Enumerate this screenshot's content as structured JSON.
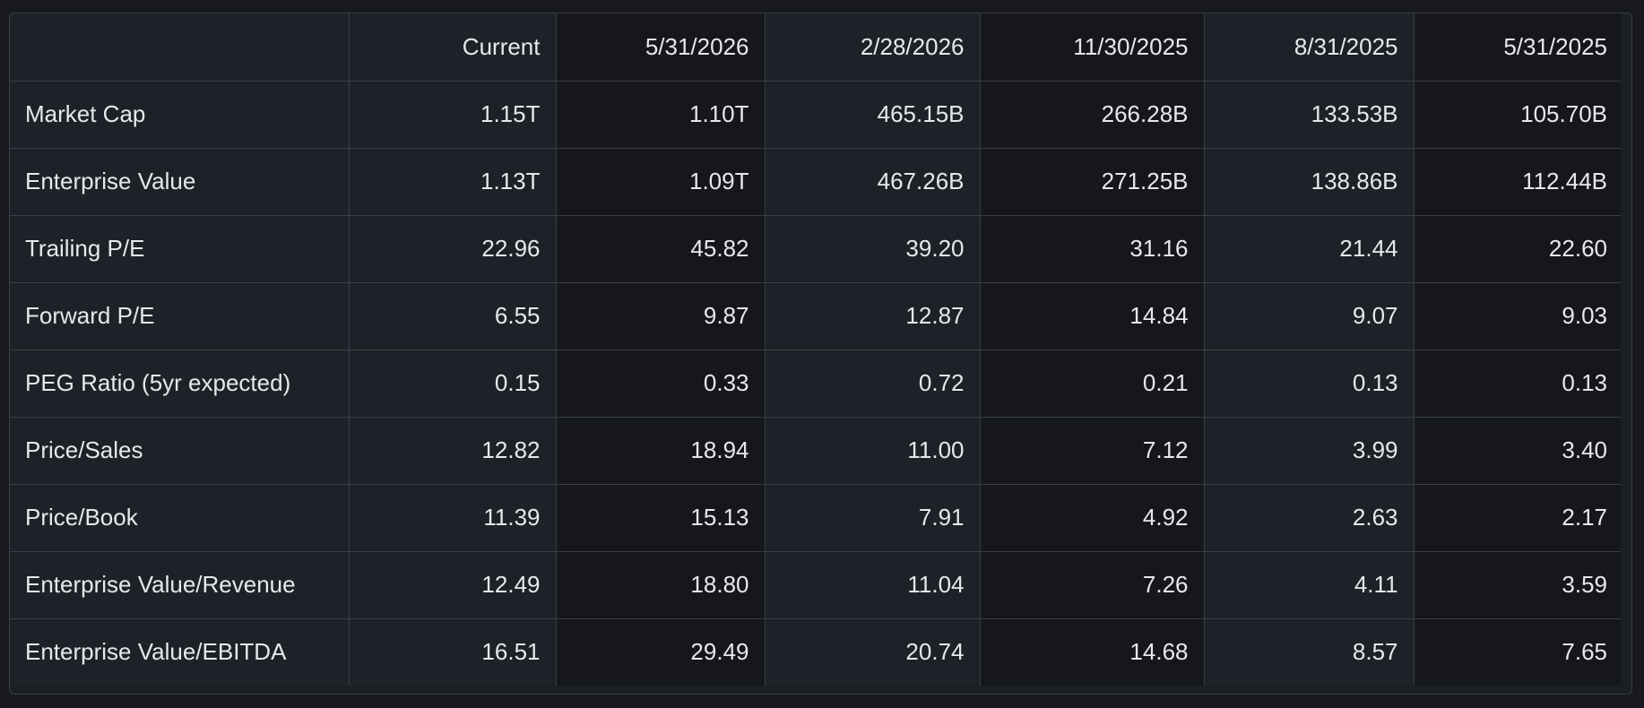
{
  "table": {
    "columns": [
      "",
      "Current",
      "5/31/2026",
      "2/28/2026",
      "11/30/2025",
      "8/31/2025",
      "5/31/2025"
    ],
    "rows": [
      {
        "label": "Market Cap",
        "values": [
          "1.15T",
          "1.10T",
          "465.15B",
          "266.28B",
          "133.53B",
          "105.70B"
        ]
      },
      {
        "label": "Enterprise Value",
        "values": [
          "1.13T",
          "1.09T",
          "467.26B",
          "271.25B",
          "138.86B",
          "112.44B"
        ]
      },
      {
        "label": "Trailing P/E",
        "values": [
          "22.96",
          "45.82",
          "39.20",
          "31.16",
          "21.44",
          "22.60"
        ]
      },
      {
        "label": "Forward P/E",
        "values": [
          "6.55",
          "9.87",
          "12.87",
          "14.84",
          "9.07",
          "9.03"
        ]
      },
      {
        "label": "PEG Ratio (5yr expected)",
        "values": [
          "0.15",
          "0.33",
          "0.72",
          "0.21",
          "0.13",
          "0.13"
        ]
      },
      {
        "label": "Price/Sales",
        "values": [
          "12.82",
          "18.94",
          "11.00",
          "7.12",
          "3.99",
          "3.40"
        ]
      },
      {
        "label": "Price/Book",
        "values": [
          "11.39",
          "15.13",
          "7.91",
          "4.92",
          "2.63",
          "2.17"
        ]
      },
      {
        "label": "Enterprise Value/Revenue",
        "values": [
          "12.49",
          "18.80",
          "11.04",
          "7.26",
          "4.11",
          "3.59"
        ]
      },
      {
        "label": "Enterprise Value/EBITDA",
        "values": [
          "16.51",
          "29.49",
          "20.74",
          "14.68",
          "8.57",
          "7.65"
        ]
      }
    ]
  }
}
